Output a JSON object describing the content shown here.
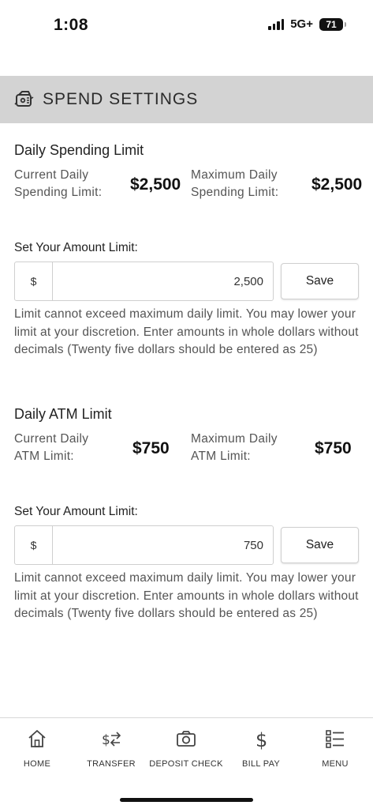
{
  "status_bar": {
    "time": "1:08",
    "network": "5G+",
    "battery": "71"
  },
  "header": {
    "title": "SPEND SETTINGS",
    "icon": "wallet-settings-icon"
  },
  "daily_spending": {
    "title": "Daily Spending Limit",
    "current_label": "Current Daily Spending Limit:",
    "current_value": "$2,500",
    "maximum_label": "Maximum Daily Spending Limit:",
    "maximum_value": "$2,500",
    "set_label": "Set Your Amount Limit:",
    "currency": "$",
    "amount": "2,500",
    "save_label": "Save",
    "help": "Limit cannot exceed maximum daily limit. You may lower your limit at your discretion. Enter amounts in whole dollars without decimals (Twenty five dollars should be entered as 25)"
  },
  "daily_atm": {
    "title": "Daily ATM Limit",
    "current_label": "Current Daily ATM Limit:",
    "current_value": "$750",
    "maximum_label": "Maximum Daily ATM Limit:",
    "maximum_value": "$750",
    "set_label": "Set Your Amount Limit:",
    "currency": "$",
    "amount": "750",
    "save_label": "Save",
    "help": "Limit cannot exceed maximum daily limit. You may lower your limit at your discretion. Enter amounts in whole dollars without decimals (Twenty five dollars should be entered as 25)"
  },
  "nav": {
    "items": [
      {
        "label": "HOME",
        "icon": "home-icon"
      },
      {
        "label": "TRANSFER",
        "icon": "transfer-icon"
      },
      {
        "label": "DEPOSIT CHECK",
        "icon": "camera-icon"
      },
      {
        "label": "BILL PAY",
        "icon": "dollar-icon"
      },
      {
        "label": "MENU",
        "icon": "menu-list-icon"
      }
    ]
  }
}
